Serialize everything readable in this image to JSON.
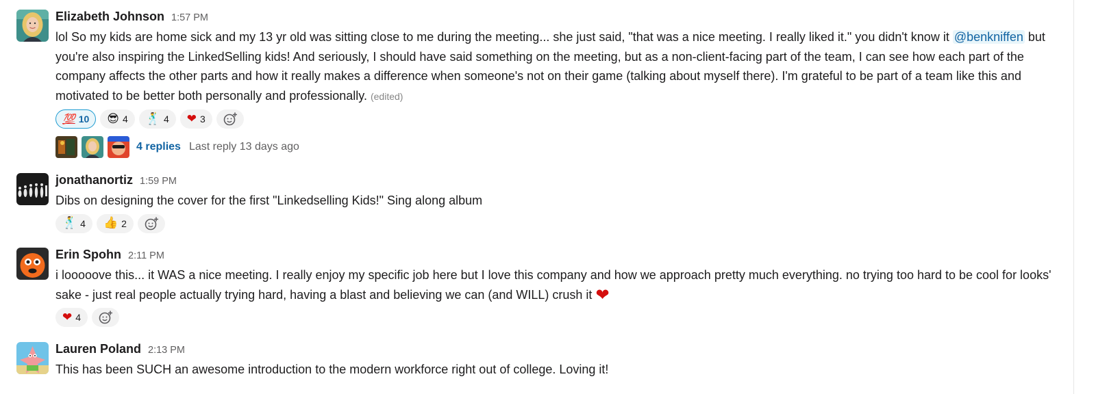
{
  "colors": {
    "link": "#1264a3",
    "mention_bg": "#e8f5fa",
    "heart": "#d40e0d",
    "active_border": "#1d9bd1"
  },
  "messages": [
    {
      "author": "Elizabeth Johnson",
      "time": "1:57 PM",
      "text_1": "lol So my kids are home sick and my 13 yr old was sitting close to me during the meeting... she just said, \"that was a nice meeting. I really liked it.\" you didn't know it ",
      "mention": "@benkniffen",
      "text_2": " but you're also inspiring the LinkedSelling kids! And seriously, I should have said something on the meeting, but as a non-client-facing part of the team, I can see how each part of the company affects the other parts and how it really makes a difference when someone's not on their game (talking about myself there). I'm grateful to be part of a team like this and motivated to be better both personally and professionally.",
      "edited": "(edited)",
      "reactions": [
        {
          "emoji": "💯",
          "icon": "hundred-points",
          "count": "10"
        },
        {
          "emoji": "😎",
          "icon": "sunglasses-face",
          "count": "4"
        },
        {
          "emoji": "🕺",
          "icon": "dancer",
          "count": "4"
        },
        {
          "emoji": "❤",
          "icon": "red-heart",
          "count": "3"
        }
      ],
      "thread": {
        "replies": "4 replies",
        "last_reply": "Last reply 13 days ago"
      }
    },
    {
      "author": "jonathanortiz",
      "time": "1:59 PM",
      "text": "Dibs on designing the cover for the first \"Linkedselling Kids!\" Sing along album",
      "reactions": [
        {
          "emoji": "🕺",
          "icon": "dancing-figure",
          "count": "4"
        },
        {
          "emoji": "👍",
          "icon": "thumbs-up",
          "count": "2"
        }
      ]
    },
    {
      "author": "Erin Spohn",
      "time": "2:11 PM",
      "text": "i looooove this... it WAS a nice meeting. I really enjoy my specific job here but I love this company and how we approach pretty much everything. no trying too hard to be cool for looks' sake - just real people actually trying hard, having a blast and believing we can (and WILL) crush it",
      "inline_emoji": "❤",
      "reactions": [
        {
          "emoji": "❤",
          "icon": "red-heart",
          "count": "4"
        }
      ]
    },
    {
      "author": "Lauren Poland",
      "time": "2:13 PM",
      "text": "This has been SUCH an awesome introduction to the modern workforce right out of college. Loving it!"
    }
  ]
}
